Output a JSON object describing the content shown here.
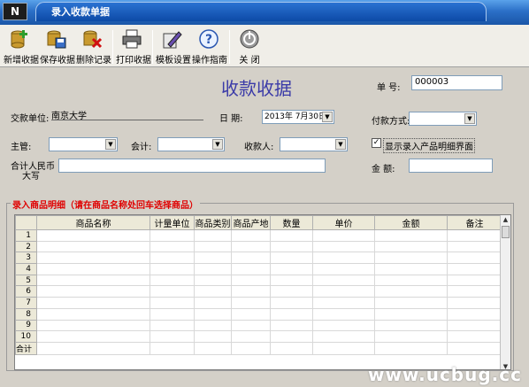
{
  "window": {
    "title": "录入收款单据"
  },
  "toolbar": {
    "new": "新增收据",
    "save": "保存收据",
    "delete": "删除记录",
    "print": "打印收据",
    "template": "模板设置",
    "guide": "操作指南",
    "close": "关 闭"
  },
  "form": {
    "heading": "收款收据",
    "doc_no_label": "单  号:",
    "doc_no_value": "000003",
    "payer_label": "交款单位:",
    "payer_value": "南京大学",
    "date_label": "日   期:",
    "date_value": "2013年 7月30日",
    "payment_label": "付款方式:",
    "payment_value": "",
    "supervisor_label": "主管:",
    "supervisor_value": "",
    "accountant_label": "会计:",
    "accountant_value": "",
    "cashier_label": "收款人:",
    "cashier_value": "",
    "show_detail_label": "显示录入产品明细界面",
    "show_detail_checked": "✓",
    "total_rmb_label_1": "合计人民币",
    "total_rmb_label_2": "大写",
    "total_rmb_value": "",
    "amount_label": "金   额:",
    "amount_value": ""
  },
  "detail": {
    "title": "录入商品明细（请在商品名称处回车选择商品）",
    "columns": [
      "",
      "商品名称",
      "计量单位",
      "商品类别",
      "商品产地",
      "数量",
      "单价",
      "金额",
      "备注"
    ],
    "row_numbers": [
      "1",
      "2",
      "3",
      "4",
      "5",
      "6",
      "7",
      "8",
      "9",
      "10"
    ],
    "total_label": "合计"
  },
  "watermark": "www.ucbug.cc"
}
